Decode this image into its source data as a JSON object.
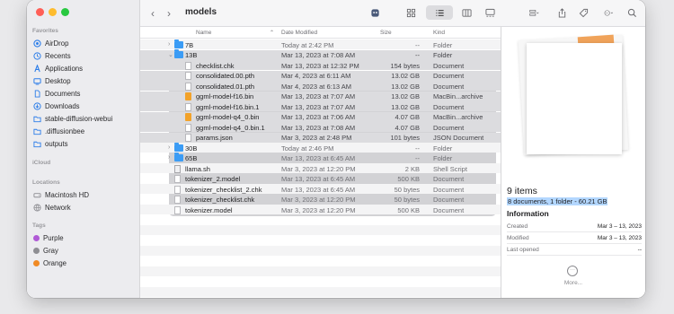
{
  "toolbar": {
    "back": "‹",
    "forward": "›",
    "title": "models"
  },
  "sidebar": {
    "favorites_title": "Favorites",
    "favorites": [
      {
        "label": "AirDrop",
        "icon": "airdrop-icon"
      },
      {
        "label": "Recents",
        "icon": "clock-icon"
      },
      {
        "label": "Applications",
        "icon": "applications-icon"
      },
      {
        "label": "Desktop",
        "icon": "desktop-icon"
      },
      {
        "label": "Documents",
        "icon": "document-icon"
      },
      {
        "label": "Downloads",
        "icon": "download-icon"
      },
      {
        "label": "stable-diffusion-webui",
        "icon": "folder-icon"
      },
      {
        "label": ".diffusionbee",
        "icon": "folder-icon"
      },
      {
        "label": "outputs",
        "icon": "folder-icon"
      }
    ],
    "icloud_title": "iCloud",
    "locations_title": "Locations",
    "locations": [
      {
        "label": "Macintosh HD",
        "icon": "disk-icon"
      },
      {
        "label": "Network",
        "icon": "network-icon"
      }
    ],
    "tags_title": "Tags",
    "tags": [
      {
        "label": "Purple",
        "color": "#b05ad6"
      },
      {
        "label": "Gray",
        "color": "#8e8e93"
      },
      {
        "label": "Orange",
        "color": "#f08a24"
      }
    ]
  },
  "columns": {
    "name": "Name",
    "date": "Date Modified",
    "size": "Size",
    "kind": "Kind"
  },
  "files": [
    {
      "name": "7B",
      "date": "Today at 2:42 PM",
      "size": "--",
      "kind": "Folder",
      "type": "folder",
      "disclosure": "›"
    },
    {
      "name": "13B",
      "date": "Mar 13, 2023 at 7:08 AM",
      "size": "--",
      "kind": "Folder",
      "type": "folder",
      "disclosure": "⌄"
    },
    {
      "name": "checklist.chk",
      "date": "Mar 13, 2023 at 12:32 PM",
      "size": "154 bytes",
      "kind": "Document",
      "type": "doc"
    },
    {
      "name": "consolidated.00.pth",
      "date": "Mar 4, 2023 at 6:11 AM",
      "size": "13.02 GB",
      "kind": "Document",
      "type": "doc"
    },
    {
      "name": "consolidated.01.pth",
      "date": "Mar 4, 2023 at 6:13 AM",
      "size": "13.02 GB",
      "kind": "Document",
      "type": "doc"
    },
    {
      "name": "ggml-model-f16.bin",
      "date": "Mar 13, 2023 at 7:07 AM",
      "size": "13.02 GB",
      "kind": "MacBin...archive",
      "type": "bin"
    },
    {
      "name": "ggml-model-f16.bin.1",
      "date": "Mar 13, 2023 at 7:07 AM",
      "size": "13.02 GB",
      "kind": "Document",
      "type": "doc"
    },
    {
      "name": "ggml-model-q4_0.bin",
      "date": "Mar 13, 2023 at 7:06 AM",
      "size": "4.07 GB",
      "kind": "MacBin...archive",
      "type": "bin"
    },
    {
      "name": "ggml-model-q4_0.bin.1",
      "date": "Mar 13, 2023 at 7:08 AM",
      "size": "4.07 GB",
      "kind": "Document",
      "type": "doc"
    },
    {
      "name": "params.json",
      "date": "Mar 3, 2023 at 2:48 PM",
      "size": "101 bytes",
      "kind": "JSON Document",
      "type": "doc"
    },
    {
      "name": "30B",
      "date": "Today at 2:46 PM",
      "size": "--",
      "kind": "Folder",
      "type": "folder",
      "disclosure": "›"
    },
    {
      "name": "65B",
      "date": "Mar 13, 2023 at 6:45 AM",
      "size": "--",
      "kind": "Folder",
      "type": "folder",
      "disclosure": "›"
    },
    {
      "name": "llama.sh",
      "date": "Mar 3, 2023 at 12:20 PM",
      "size": "2 KB",
      "kind": "Shell Script",
      "type": "sh"
    },
    {
      "name": "tokenizer_2.model",
      "date": "Mar 13, 2023 at 6:45 AM",
      "size": "500 KB",
      "kind": "Document",
      "type": "doc"
    },
    {
      "name": "tokenizer_checklist_2.chk",
      "date": "Mar 13, 2023 at 6:45 AM",
      "size": "50 bytes",
      "kind": "Document",
      "type": "doc"
    },
    {
      "name": "tokenizer_checklist.chk",
      "date": "Mar 3, 2023 at 12:20 PM",
      "size": "50 bytes",
      "kind": "Document",
      "type": "doc"
    },
    {
      "name": "tokenizer.model",
      "date": "Mar 3, 2023 at 12:20 PM",
      "size": "500 KB",
      "kind": "Document",
      "type": "doc"
    }
  ],
  "preview": {
    "title": "9 items",
    "subtitle": "8 documents, 1 folder - 60.21 GB",
    "info_title": "Information",
    "rows": [
      {
        "label": "Created",
        "value": "Mar 3 – 13, 2023"
      },
      {
        "label": "Modified",
        "value": "Mar 3 – 13, 2023"
      },
      {
        "label": "Last opened",
        "value": "--"
      }
    ],
    "more_label": "More...",
    "more_glyph": "···"
  }
}
